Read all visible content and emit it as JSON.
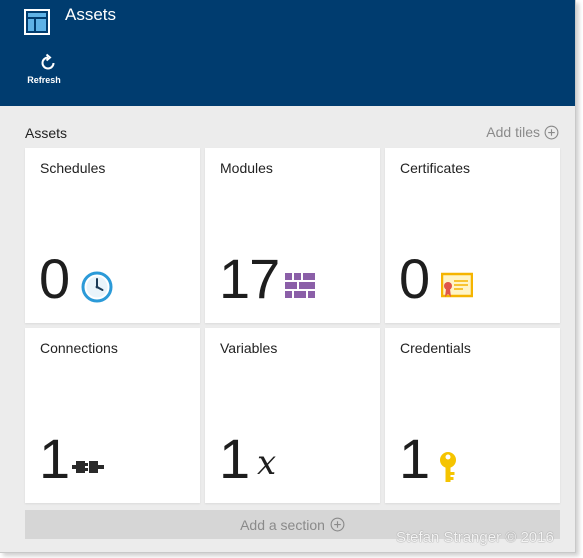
{
  "header": {
    "title": "Assets",
    "refresh_label": "Refresh"
  },
  "section": {
    "title": "Assets",
    "add_tiles_label": "Add tiles"
  },
  "tiles": [
    {
      "title": "Schedules",
      "count": "0",
      "icon": "clock-icon"
    },
    {
      "title": "Modules",
      "count": "17",
      "icon": "modules-icon"
    },
    {
      "title": "Certificates",
      "count": "0",
      "icon": "certificate-icon"
    },
    {
      "title": "Connections",
      "count": "1",
      "icon": "connection-icon"
    },
    {
      "title": "Variables",
      "count": "1",
      "icon": "variable-x-icon"
    },
    {
      "title": "Credentials",
      "count": "1",
      "icon": "key-icon"
    }
  ],
  "footer": {
    "add_section_label": "Add a section"
  },
  "watermark": "Stefan Stranger © 2016",
  "colors": {
    "header_bg": "#003c6f",
    "page_bg": "#ececec",
    "tile_bg": "#ffffff",
    "modules_purple": "#8b5fa8",
    "certificate_yellow": "#f5b400",
    "clock_blue": "#2b9ad8"
  }
}
